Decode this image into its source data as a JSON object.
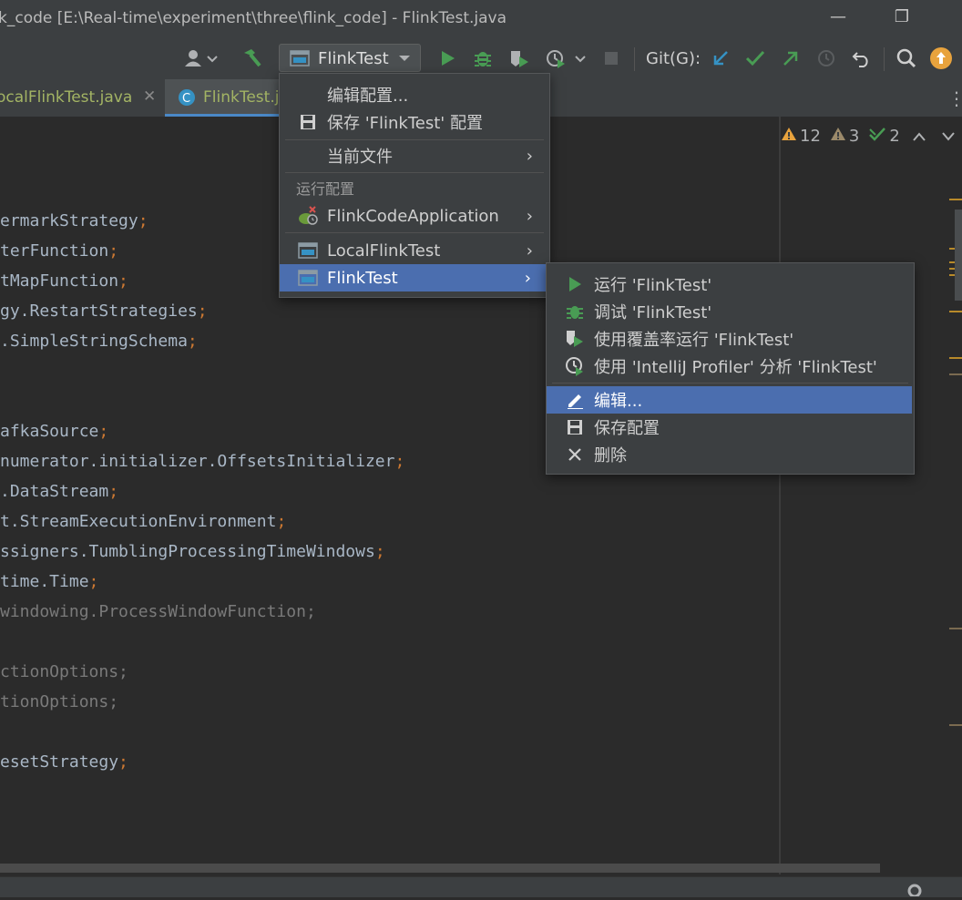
{
  "window": {
    "title": "k_code [E:\\Real-time\\experiment\\three\\flink_code] - FlinkTest.java"
  },
  "toolbar": {
    "run_config": "FlinkTest",
    "git_label": "Git(G):"
  },
  "tabs": [
    {
      "label": "ocalFlinkTest.java"
    },
    {
      "label": "FlinkTest.j"
    }
  ],
  "inspection": {
    "warnings": "12",
    "weak_warnings": "3",
    "ok": "2"
  },
  "code_lines": [
    "ermarkStrategy",
    "terFunction",
    "tMapFunction",
    "gy.RestartStrategies",
    ".SimpleStringSchema",
    "",
    "",
    "afkaSource",
    "numerator.initializer.OffsetsInitializer",
    ".DataStream",
    "t.StreamExecutionEnvironment",
    "ssigners.TumblingProcessingTimeWindows",
    "time.Time",
    "windowing.ProcessWindowFunction",
    "",
    "ctionOptions",
    "tionOptions",
    "",
    "esetStrategy"
  ],
  "menu": {
    "items": [
      {
        "label": "编辑配置..."
      },
      {
        "label": "保存 'FlinkTest' 配置"
      },
      {
        "label": "当前文件"
      },
      {
        "label": "运行配置"
      },
      {
        "label": "FlinkCodeApplication"
      },
      {
        "label": "LocalFlinkTest"
      },
      {
        "label": "FlinkTest"
      }
    ]
  },
  "submenu": {
    "items": [
      {
        "label": "运行 'FlinkTest'"
      },
      {
        "label": "调试 'FlinkTest'"
      },
      {
        "label": "使用覆盖率运行  'FlinkTest'"
      },
      {
        "label": "使用 'IntelliJ Profiler' 分析  'FlinkTest'"
      },
      {
        "label": "编辑..."
      },
      {
        "label": "保存配置"
      },
      {
        "label": "删除"
      }
    ]
  },
  "colors": {
    "accent": "#4b6eaf",
    "run_green": "#499c54",
    "warning": "#e8a33d"
  }
}
